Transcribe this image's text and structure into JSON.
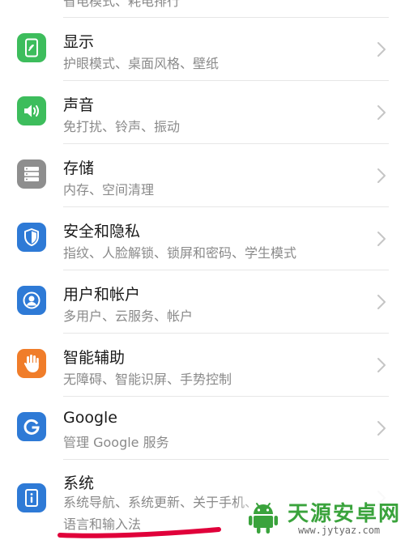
{
  "top_partial_text": "省电模式、耗电排行",
  "colors": {
    "green": "#3dbd5c",
    "gray": "#8e8e8e",
    "blue": "#2e7ad6",
    "orange": "#f07d2a",
    "title": "#1a1a1a",
    "subtitle": "#8a8a8a",
    "chevron": "#c5c5c5",
    "watermark_green": "#3aa33c",
    "underline_red": "#e0003a"
  },
  "settings": {
    "items": [
      {
        "title": "显示",
        "subtitle": "护眼模式、桌面风格、壁纸",
        "icon": "display-phone-icon",
        "color": "green"
      },
      {
        "title": "声音",
        "subtitle": "免打扰、铃声、振动",
        "icon": "speaker-icon",
        "color": "green"
      },
      {
        "title": "存储",
        "subtitle": "内存、空间清理",
        "icon": "storage-icon",
        "color": "gray"
      },
      {
        "title": "安全和隐私",
        "subtitle": "指纹、人脸解锁、锁屏和密码、学生模式",
        "icon": "shield-icon",
        "color": "blue"
      },
      {
        "title": "用户和帐户",
        "subtitle": "多用户、云服务、帐户",
        "icon": "user-icon",
        "color": "blue"
      },
      {
        "title": "智能辅助",
        "subtitle": "无障碍、智能识屏、手势控制",
        "icon": "hand-icon",
        "color": "orange"
      },
      {
        "title": "Google",
        "subtitle": "管理 Google 服务",
        "icon": "google-icon",
        "color": "blue"
      },
      {
        "title": "系统",
        "subtitle": "系统导航、系统更新、关于手机、语言和输入法",
        "icon": "system-info-icon",
        "color": "blue"
      }
    ]
  },
  "watermark": {
    "name": "天源安卓网",
    "url": "www.jytyaz.com",
    "icon": "android-logo-icon"
  }
}
